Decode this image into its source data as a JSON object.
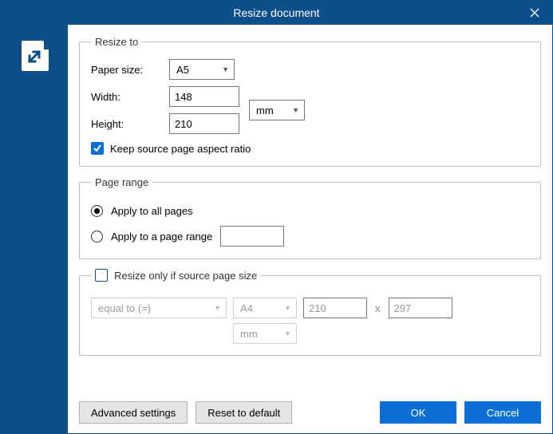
{
  "title": "Resize document",
  "resize_to": {
    "legend": "Resize to",
    "paper_size_label": "Paper size:",
    "paper_size_value": "A5",
    "width_label": "Width:",
    "width_value": "148",
    "height_label": "Height:",
    "height_value": "210",
    "unit_value": "mm",
    "keep_aspect_label": "Keep source page aspect ratio",
    "keep_aspect_checked": true
  },
  "page_range": {
    "legend": "Page range",
    "apply_all_label": "Apply to all pages",
    "apply_range_label": "Apply to a page range",
    "selected": "all",
    "range_value": ""
  },
  "condition": {
    "legend": "Resize only if source page size",
    "enabled": false,
    "operator_value": "equal to (=)",
    "paper_value": "A4",
    "w_value": "210",
    "h_value": "297",
    "x_sep": "x",
    "unit_value": "mm"
  },
  "buttons": {
    "advanced": "Advanced settings",
    "reset": "Reset to default",
    "ok": "OK",
    "cancel": "Cancel"
  }
}
